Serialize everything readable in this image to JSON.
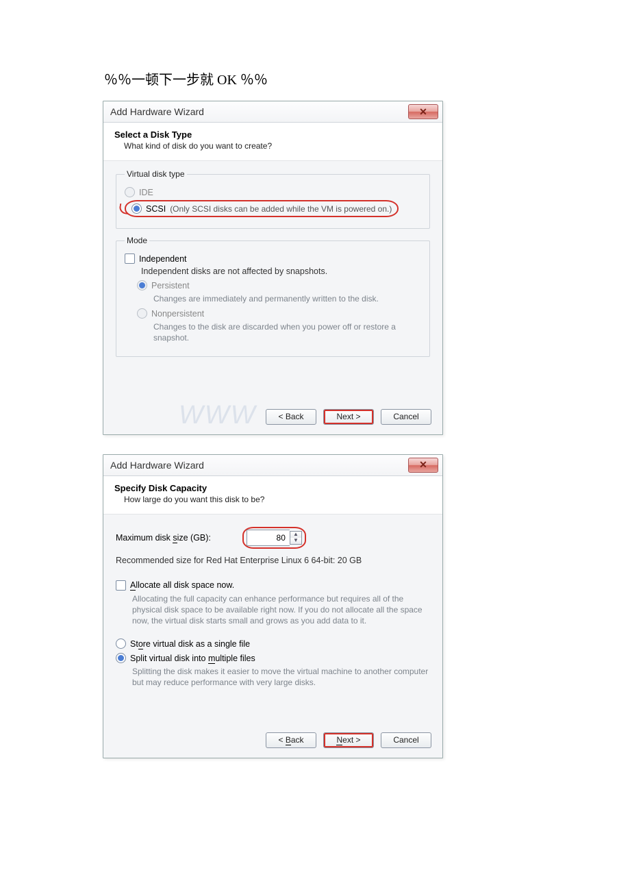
{
  "heading": "％％一顿下一步就 OK   ％％",
  "dialog1": {
    "title": "Add Hardware Wizard",
    "close_glyph": "✕",
    "header_title": "Select a Disk Type",
    "header_sub": "What kind of disk do you want to create?",
    "group_disk_type": "Virtual disk type",
    "opt_ide": "IDE",
    "opt_scsi_prefix": "SCSI",
    "opt_scsi_note": "(Only SCSI disks can be added while the VM is powered on.)",
    "group_mode": "Mode",
    "chk_independent": "Independent",
    "independent_note": "Independent disks are not affected by snapshots.",
    "opt_persistent": "Persistent",
    "persistent_desc": "Changes are immediately and permanently written to the disk.",
    "opt_nonpersistent": "Nonpersistent",
    "nonpersistent_desc": "Changes to the disk are discarded when you power off or restore a snapshot.",
    "btn_back": "< Back",
    "btn_next": "Next >",
    "btn_cancel": "Cancel"
  },
  "dialog2": {
    "title": "Add Hardware Wizard",
    "close_glyph": "✕",
    "header_title": "Specify Disk Capacity",
    "header_sub": "How large do you want this disk to be?",
    "label_max_size": "Maximum disk size (GB):",
    "max_size_value": "80",
    "recommended": "Recommended size for Red Hat Enterprise Linux 6 64-bit: 20 GB",
    "chk_allocate": "Allocate all disk space now.",
    "allocate_desc": "Allocating the full capacity can enhance performance but requires all of the physical disk space to be available right now. If you do not allocate all the space now, the virtual disk starts small and grows as you add data to it.",
    "opt_single": "Store virtual disk as a single file",
    "opt_multi": "Split virtual disk into multiple files",
    "multi_desc": "Splitting the disk makes it easier to move the virtual machine to another computer but may reduce performance with very large disks.",
    "btn_back": "< Back",
    "btn_next": "Next >",
    "btn_cancel": "Cancel"
  }
}
